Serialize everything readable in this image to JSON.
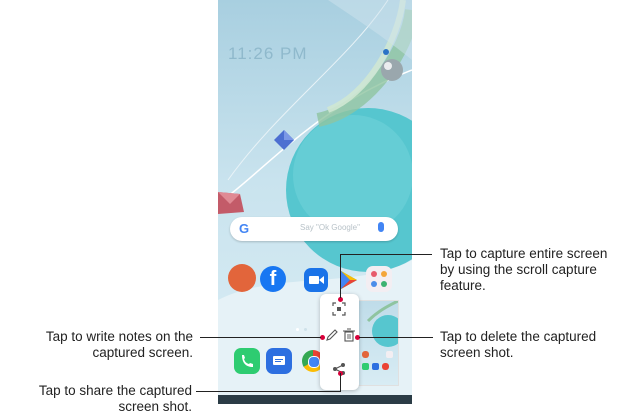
{
  "phone": {
    "clock": "11:26 PM",
    "search": {
      "logo": "G",
      "placeholder": "Say \"Ok Google\""
    }
  },
  "apps": {
    "facebook_label": "f",
    "chrome_label": "",
    "messages_label": ""
  },
  "toolbar": {
    "icons": [
      "scroll-capture-icon",
      "pen-icon",
      "trash-icon",
      "share-icon"
    ]
  },
  "callouts": {
    "scroll_capture": "Tap to capture entire screen by using the scroll capture feature.",
    "write_notes": "Tap to write notes on the captured screen.",
    "delete": "Tap to delete the captured screen shot.",
    "share": "Tap to share the captured screen shot."
  },
  "colors": {
    "accent_dot": "#d9003a",
    "wallpaper_sky": "#a8cfe0",
    "sphere": "#56c6cf"
  }
}
